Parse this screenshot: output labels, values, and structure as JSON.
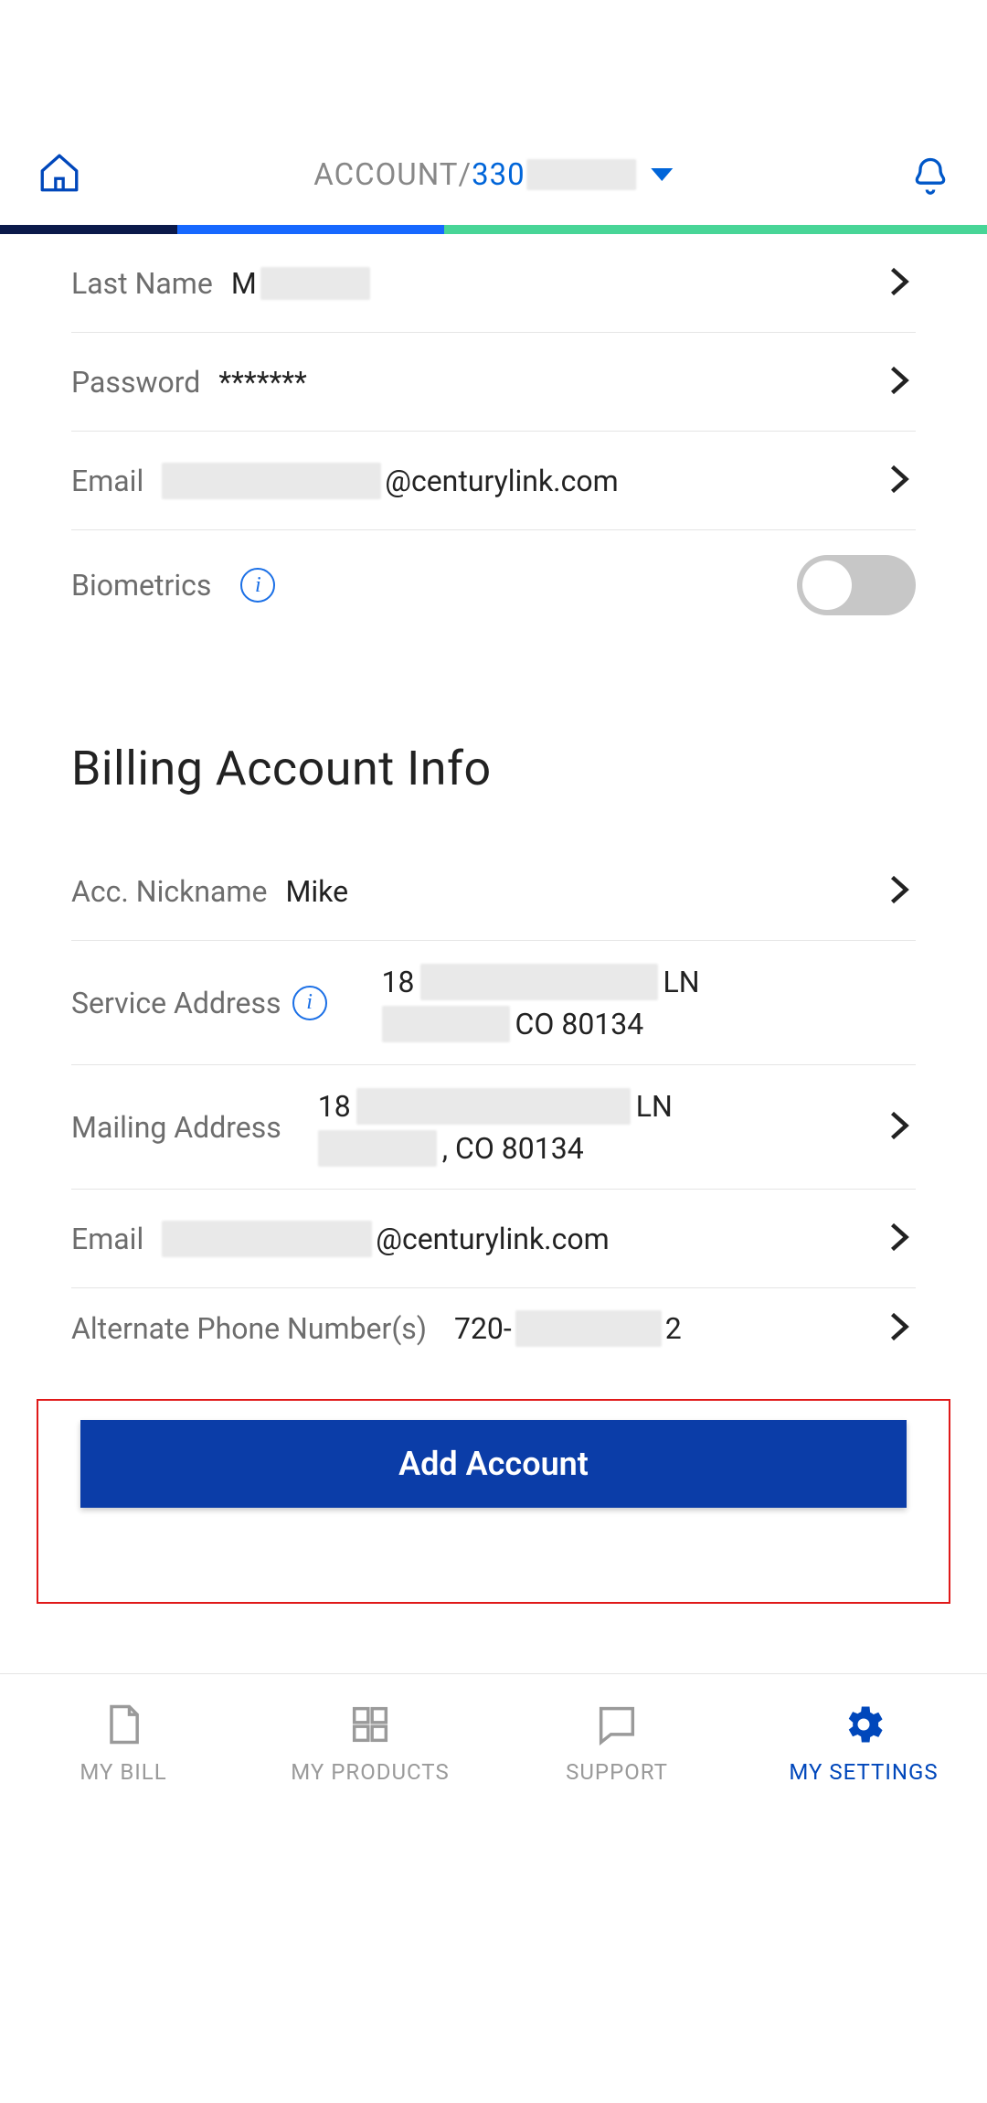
{
  "header": {
    "prelabel": "ACCOUNT/",
    "account_prefix": "330"
  },
  "profile_rows": {
    "last_name": {
      "label": "Last Name",
      "value_prefix": "M"
    },
    "password": {
      "label": "Password",
      "value": "*******"
    },
    "email": {
      "label": "Email",
      "value_suffix": "@centurylink.com"
    },
    "biometrics": {
      "label": "Biometrics"
    }
  },
  "billing": {
    "section_title": "Billing Account Info",
    "nickname": {
      "label": "Acc. Nickname",
      "value": "Mike"
    },
    "service_address": {
      "label": "Service Address",
      "line1_prefix": "18",
      "line1_suffix": " LN",
      "line2_suffix": "CO 80134"
    },
    "mailing_address": {
      "label": "Mailing Address",
      "line1_prefix": "18",
      "line1_suffix": " LN",
      "line2_suffix": ", CO 80134"
    },
    "email": {
      "label": "Email",
      "value_suffix": "@centurylink.com"
    },
    "alt_phone": {
      "label": "Alternate Phone Number(s)",
      "prefix": "720-",
      "suffix": "2"
    }
  },
  "add_account_label": "Add Account",
  "nav": {
    "bill": "MY BILL",
    "products": "MY PRODUCTS",
    "support": "SUPPORT",
    "settings": "MY SETTINGS"
  }
}
